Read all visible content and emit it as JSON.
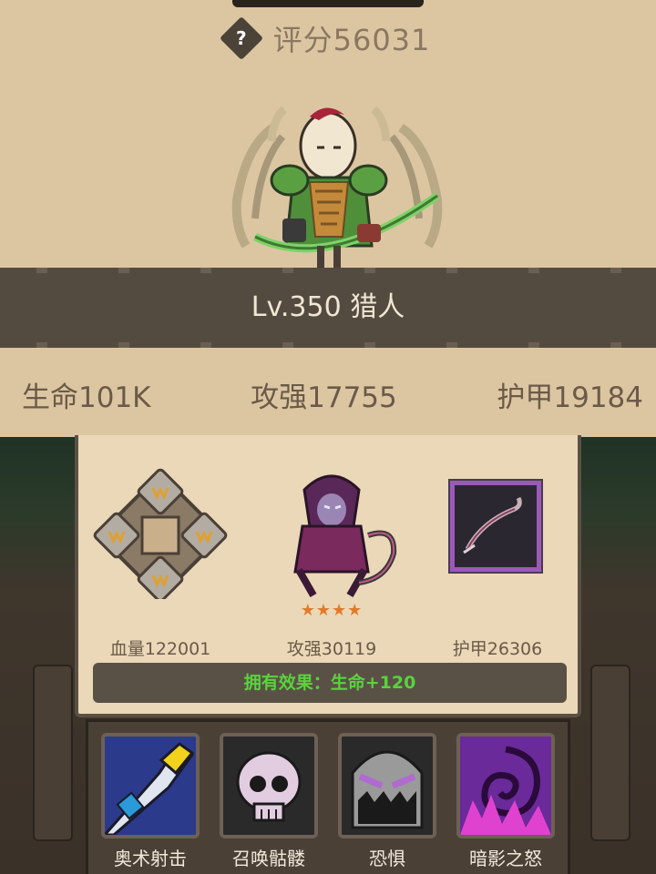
{
  "header": {
    "help_glyph": "?",
    "score_label": "评分56031"
  },
  "hero": {
    "level_title": "Lv.350 猎人",
    "icon": "hunter-hero-sprite"
  },
  "stats": {
    "hp": "生命101K",
    "attack": "攻强17755",
    "armor": "护甲19184"
  },
  "equipment": {
    "items": [
      {
        "icon": "rune-cross-icon",
        "label": "血量122001"
      },
      {
        "icon": "dark-ranger-pet-icon",
        "label": "攻强30119",
        "stars": "★★★★"
      },
      {
        "icon": "bow-icon",
        "label": "护甲26306"
      }
    ],
    "effect": "拥有效果：生命+120"
  },
  "skills": [
    {
      "icon": "arcane-shot-icon",
      "label": "奥术射击"
    },
    {
      "icon": "summon-skeleton-icon",
      "label": "召唤骷髅"
    },
    {
      "icon": "fear-icon",
      "label": "恐惧"
    },
    {
      "icon": "shadow-wrath-icon",
      "label": "暗影之怒"
    }
  ],
  "colors": {
    "panel": "#dcc6a2",
    "band": "#544b40",
    "effect_green": "#59d33c",
    "star_orange": "#e07b2a",
    "rare_purple": "#9a5ab8"
  }
}
